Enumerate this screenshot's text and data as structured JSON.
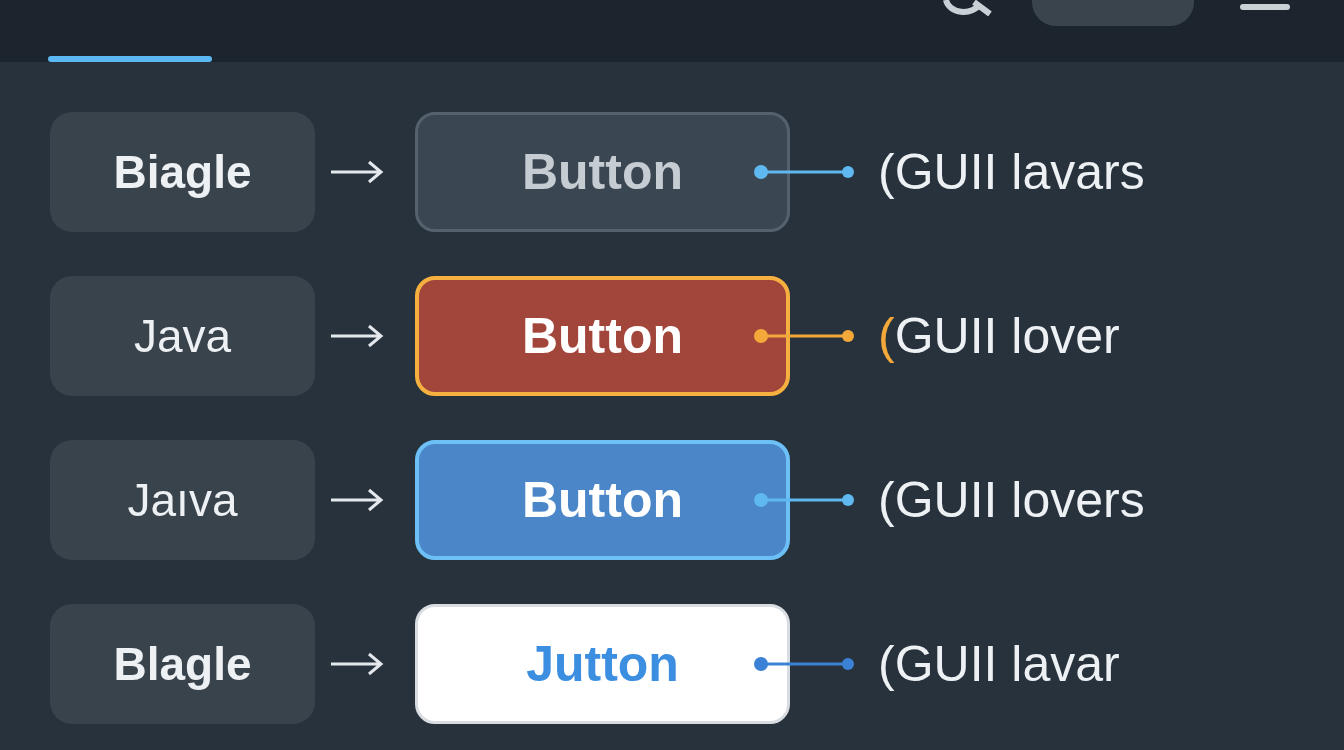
{
  "header": {
    "tab_selected": true
  },
  "rows": [
    {
      "label": "Biagle",
      "bold": true,
      "button": {
        "text": "Button",
        "kind": "ghost"
      },
      "color": "#5fb8f0",
      "note": "(GUII lavars",
      "note_accent": false
    },
    {
      "label": "Java",
      "bold": false,
      "button": {
        "text": "Button",
        "kind": "danger"
      },
      "color": "#f5a83a",
      "note": "(GUII lover",
      "note_accent": true
    },
    {
      "label": "Jaıva",
      "bold": false,
      "button": {
        "text": "Button",
        "kind": "primary"
      },
      "color": "#5fb8f0",
      "note": "(GUII lovers",
      "note_accent": false
    },
    {
      "label": "Blagle",
      "bold": true,
      "button": {
        "text": "Jutton",
        "kind": "light"
      },
      "color": "#3b82d6",
      "note": "(GUII lavar",
      "note_accent": false
    }
  ]
}
